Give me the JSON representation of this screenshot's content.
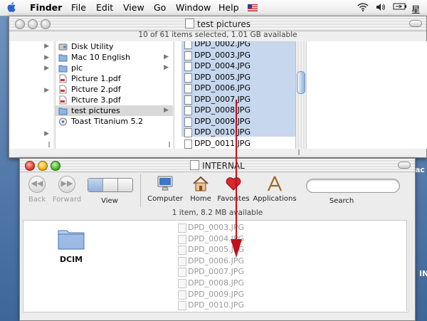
{
  "menubar": {
    "app": "Finder",
    "items": [
      "File",
      "Edit",
      "View",
      "Go",
      "Window",
      "Help"
    ],
    "clock": "星期"
  },
  "finder_window": {
    "title": "test pictures",
    "status": "10 of 61 items selected, 1.01 GB available",
    "column1": [
      {
        "label": "Disk Utility",
        "icon": "disk-utility-icon",
        "arrow": false
      },
      {
        "label": "Mac 10 English",
        "icon": "folder-icon",
        "arrow": true
      },
      {
        "label": "pic",
        "icon": "folder-icon",
        "arrow": true
      },
      {
        "label": "Picture 1.pdf",
        "icon": "pdf-icon",
        "arrow": false
      },
      {
        "label": "Picture 2.pdf",
        "icon": "pdf-icon",
        "arrow": false
      },
      {
        "label": "Picture 3.pdf",
        "icon": "pdf-icon",
        "arrow": false
      },
      {
        "label": "test pictures",
        "icon": "folder-icon",
        "arrow": true
      },
      {
        "label": "Toast Titanium 5.2",
        "icon": "toast-icon",
        "arrow": false
      }
    ],
    "column2": [
      {
        "label": "DPD_0002.JPG",
        "selected": true
      },
      {
        "label": "DPD_0003.JPG",
        "selected": true
      },
      {
        "label": "DPD_0004.JPG",
        "selected": true
      },
      {
        "label": "DPD_0005.JPG",
        "selected": true
      },
      {
        "label": "DPD_0006.JPG",
        "selected": true
      },
      {
        "label": "DPD_0007.JPG",
        "selected": true
      },
      {
        "label": "DPD_0008.JPG",
        "selected": true
      },
      {
        "label": "DPD_0009.JPG",
        "selected": true
      },
      {
        "label": "DPD_0010.JPG",
        "selected": true
      },
      {
        "label": "DPD_0011.JPG",
        "selected": false
      }
    ]
  },
  "internal_window": {
    "title": "INTERNAL",
    "status": "1 item, 8.2 MB available",
    "toolbar": {
      "back": "Back",
      "forward": "Forward",
      "view": "View",
      "computer": "Computer",
      "home": "Home",
      "favorites": "Favorites",
      "applications": "Applications",
      "search": "Search"
    },
    "folder": "DCIM"
  },
  "drag_ghost": [
    "DPD_0003.JPG",
    "DPD_0004.JPG",
    "DPD_0005.JPG",
    "DPD_0006.JPG",
    "DPD_0007.JPG",
    "DPD_0008.JPG",
    "DPD_0009.JPG",
    "DPD_0010.JPG"
  ],
  "desktop_labels": {
    "mac": "ac",
    "in": "IN"
  },
  "colors": {
    "selection": "#c6d7ee",
    "drag_arrow": "#c0101a",
    "desktop": "#5a7fa8"
  }
}
